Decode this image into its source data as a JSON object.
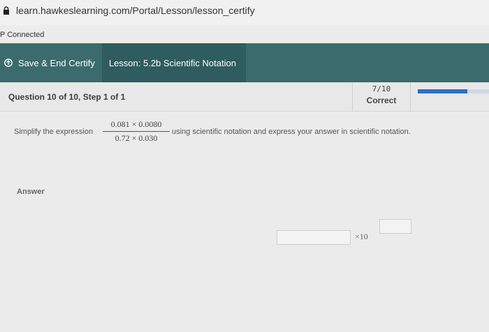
{
  "browser": {
    "url": "learn.hawkeslearning.com/Portal/Lesson/lesson_certify"
  },
  "status": {
    "text": "P Connected"
  },
  "header": {
    "save_end_label": "Save & End Certify",
    "lesson_label": "Lesson: 5.2b Scientific Notation"
  },
  "question": {
    "label": "Question 10 of 10, Step 1 of 1",
    "score": "7/10",
    "result": "Correct",
    "progress_fraction": 0.7
  },
  "problem": {
    "prefix": "Simplify the expression",
    "numerator": "0.081 × 0.0080",
    "denominator": "0.72 × 0.030",
    "suffix": "using scientific notation and express your answer in scientific notation."
  },
  "answer": {
    "label": "Answer",
    "mantissa_value": "",
    "times_ten": "×10",
    "exponent_value": ""
  },
  "colors": {
    "header_teal": "#3b6b6d",
    "progress_blue": "#2e6fc7"
  }
}
